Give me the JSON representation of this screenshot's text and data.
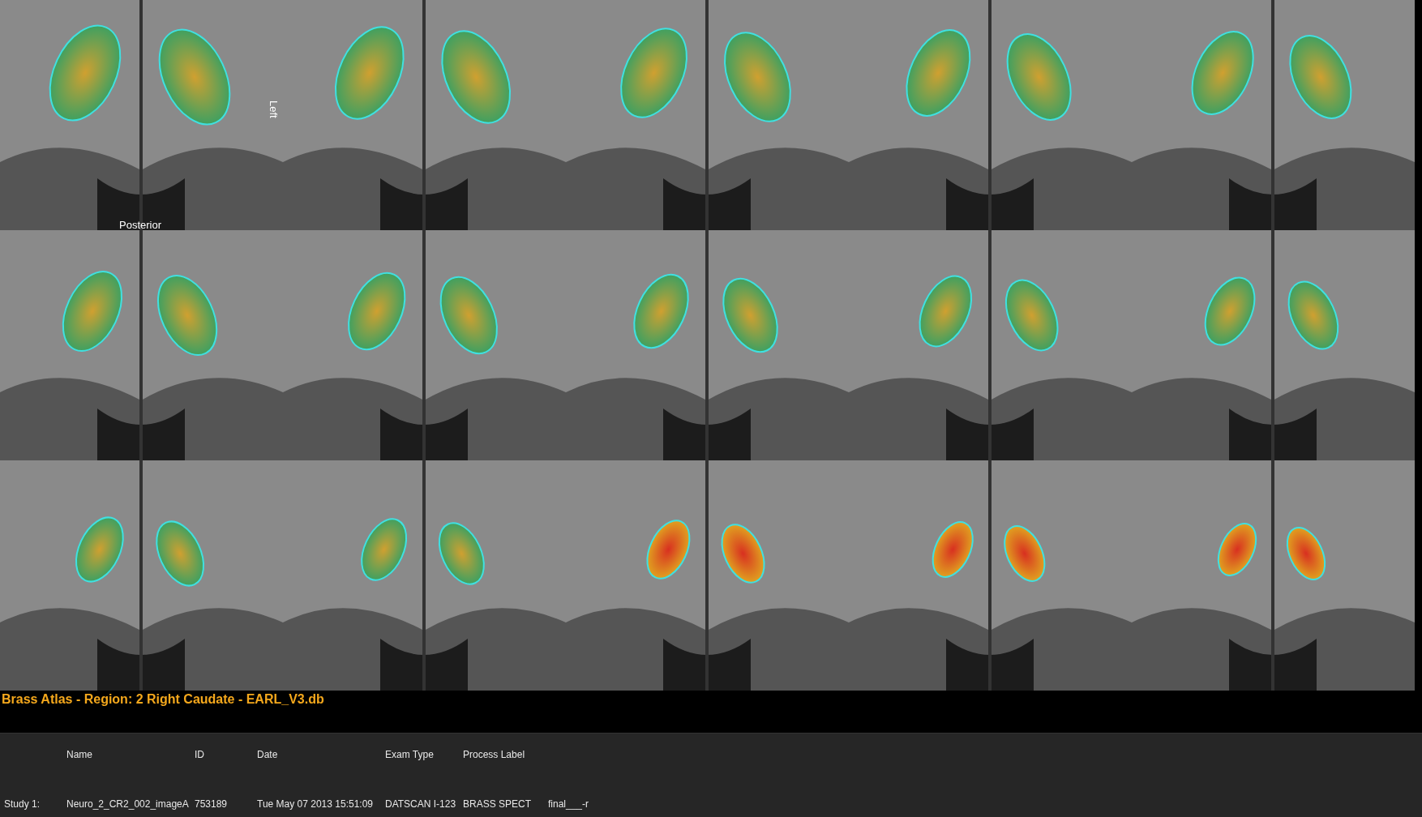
{
  "viewer": {
    "orientation_labels": [
      {
        "text": "Left",
        "kind": "vertical"
      },
      {
        "text": "Posterior",
        "kind": "horizontal"
      }
    ]
  },
  "region_title": "Brass Atlas - Region: 2 Right Caudate - EARL_V3.db",
  "study_table": {
    "columns": [
      "",
      "Name",
      "ID",
      "Date",
      "Exam Type",
      "Process Label",
      ""
    ],
    "rows": [
      [
        "Study 1:",
        "Neuro_2_CR2_002_imageA",
        "753189",
        "Tue May 07 2013 15:51:09",
        "DATSCAN I-123",
        "BRASS SPECT",
        "final___-r"
      ]
    ]
  }
}
